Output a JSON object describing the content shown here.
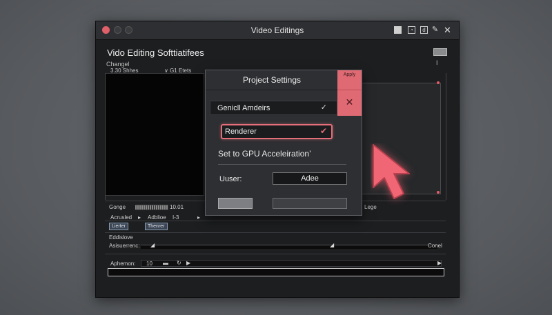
{
  "window": {
    "title": "Video Editings",
    "app_title": " Vido Editing Softtiatifees",
    "menu_label": "Changel",
    "menu_marker": "I"
  },
  "preview": {
    "left_label_a": "3.30 Shhes",
    "left_label_b": "∨ G1 Etets",
    "right_marker": "I",
    "right_label": "Lege"
  },
  "modal": {
    "title": "Project Settings",
    "apply_label": "Apply",
    "select_value": "Genicll Amdeirs",
    "renderer_value": "Renderer",
    "gpu_text": "Set to GPU Acceleiration’",
    "user_label": "Uuser:",
    "user_value": "Adee"
  },
  "bottom": {
    "gonge_label": "Gonge",
    "gonge_value": "10.01",
    "row2_a": "Acrusled",
    "row2_arrow": "▸",
    "row2_b": "Adblioe",
    "row2_c": "I-3",
    "row2_arrow2": "▸",
    "tag1": "Lierter",
    "tag2": "Thenrer",
    "section_label": "Eddislove",
    "assistance_label": "Asisuerrenc:",
    "right_label": "Conel",
    "aphemon_label": "Aphemon:",
    "aphemon_value": "10"
  },
  "colors": {
    "accent": "#e06a74",
    "window_bg": "#1d1e20",
    "modal_bg": "#2d2f32"
  }
}
